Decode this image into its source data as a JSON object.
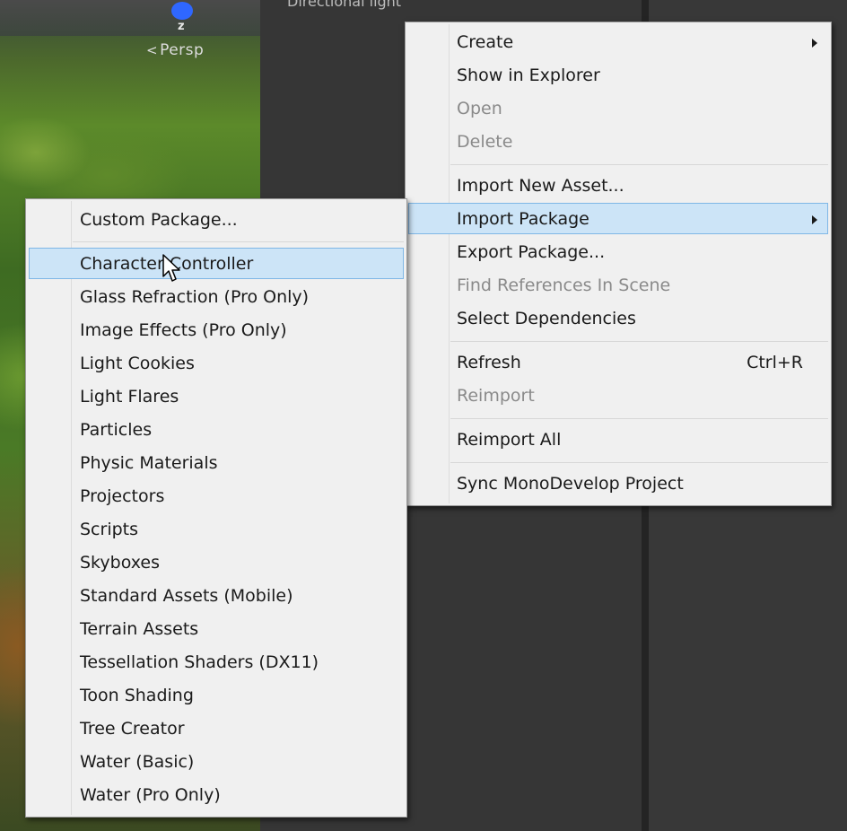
{
  "scene": {
    "axis_label": "z",
    "view_label": "Persp",
    "panel_title": "Directional light"
  },
  "context_menu": {
    "items": [
      {
        "label": "Create",
        "enabled": true,
        "submenu": true
      },
      {
        "label": "Show in Explorer",
        "enabled": true
      },
      {
        "label": "Open",
        "enabled": false
      },
      {
        "label": "Delete",
        "enabled": false
      },
      {
        "label": "Import New Asset...",
        "enabled": true
      },
      {
        "label": "Import Package",
        "enabled": true,
        "submenu": true,
        "highlighted": true
      },
      {
        "label": "Export Package...",
        "enabled": true
      },
      {
        "label": "Find References In Scene",
        "enabled": false
      },
      {
        "label": "Select Dependencies",
        "enabled": true
      },
      {
        "label": "Refresh",
        "enabled": true,
        "shortcut": "Ctrl+R"
      },
      {
        "label": "Reimport",
        "enabled": false
      },
      {
        "label": "Reimport All",
        "enabled": true
      },
      {
        "label": "Sync MonoDevelop Project",
        "enabled": true
      }
    ]
  },
  "import_package_submenu": {
    "items": [
      {
        "label": "Custom Package..."
      },
      {
        "label": "Character Controller",
        "highlighted": true
      },
      {
        "label": "Glass Refraction (Pro Only)"
      },
      {
        "label": "Image Effects (Pro Only)"
      },
      {
        "label": "Light Cookies"
      },
      {
        "label": "Light Flares"
      },
      {
        "label": "Particles"
      },
      {
        "label": "Physic Materials"
      },
      {
        "label": "Projectors"
      },
      {
        "label": "Scripts"
      },
      {
        "label": "Skyboxes"
      },
      {
        "label": "Standard Assets (Mobile)"
      },
      {
        "label": "Terrain Assets"
      },
      {
        "label": "Tessellation Shaders (DX11)"
      },
      {
        "label": "Toon Shading"
      },
      {
        "label": "Tree Creator"
      },
      {
        "label": "Water (Basic)"
      },
      {
        "label": "Water (Pro Only)"
      }
    ]
  },
  "colors": {
    "highlight_bg": "#cce4f7",
    "highlight_border": "#7fb7e6",
    "menu_bg": "#f0f0f0",
    "disabled_text": "#8a8a8a"
  },
  "icons": [
    "gizmo-sphere-icon",
    "submenu-arrow-icon",
    "mouse-pointer-icon"
  ]
}
